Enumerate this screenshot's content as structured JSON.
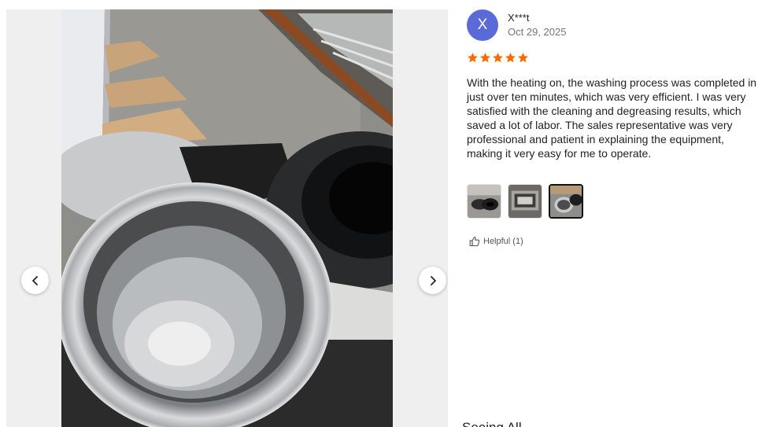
{
  "viewer": {
    "prev_icon": "chevron-left-icon",
    "next_icon": "chevron-right-icon"
  },
  "review": {
    "avatar_letter": "X",
    "avatar_color": "#5a6ad6",
    "user": "X***t",
    "date": "Oct 29, 2025",
    "rating": 5,
    "star_color": "#ff6a00",
    "text": "With the heating on, the washing process was completed in just over ten minutes, which was very efficient. I was very satisfied with the cleaning and degreasing results, which saved a lot of labor. The sales representative was very professional and patient in explaining the equipment, making it very easy for me to operate.",
    "thumbnail_count": 3,
    "active_thumbnail": 3,
    "helpful_label": "Helpful (1)",
    "helpful_icon": "thumbs-up-icon"
  },
  "next_section": {
    "label": "Seeing All"
  }
}
